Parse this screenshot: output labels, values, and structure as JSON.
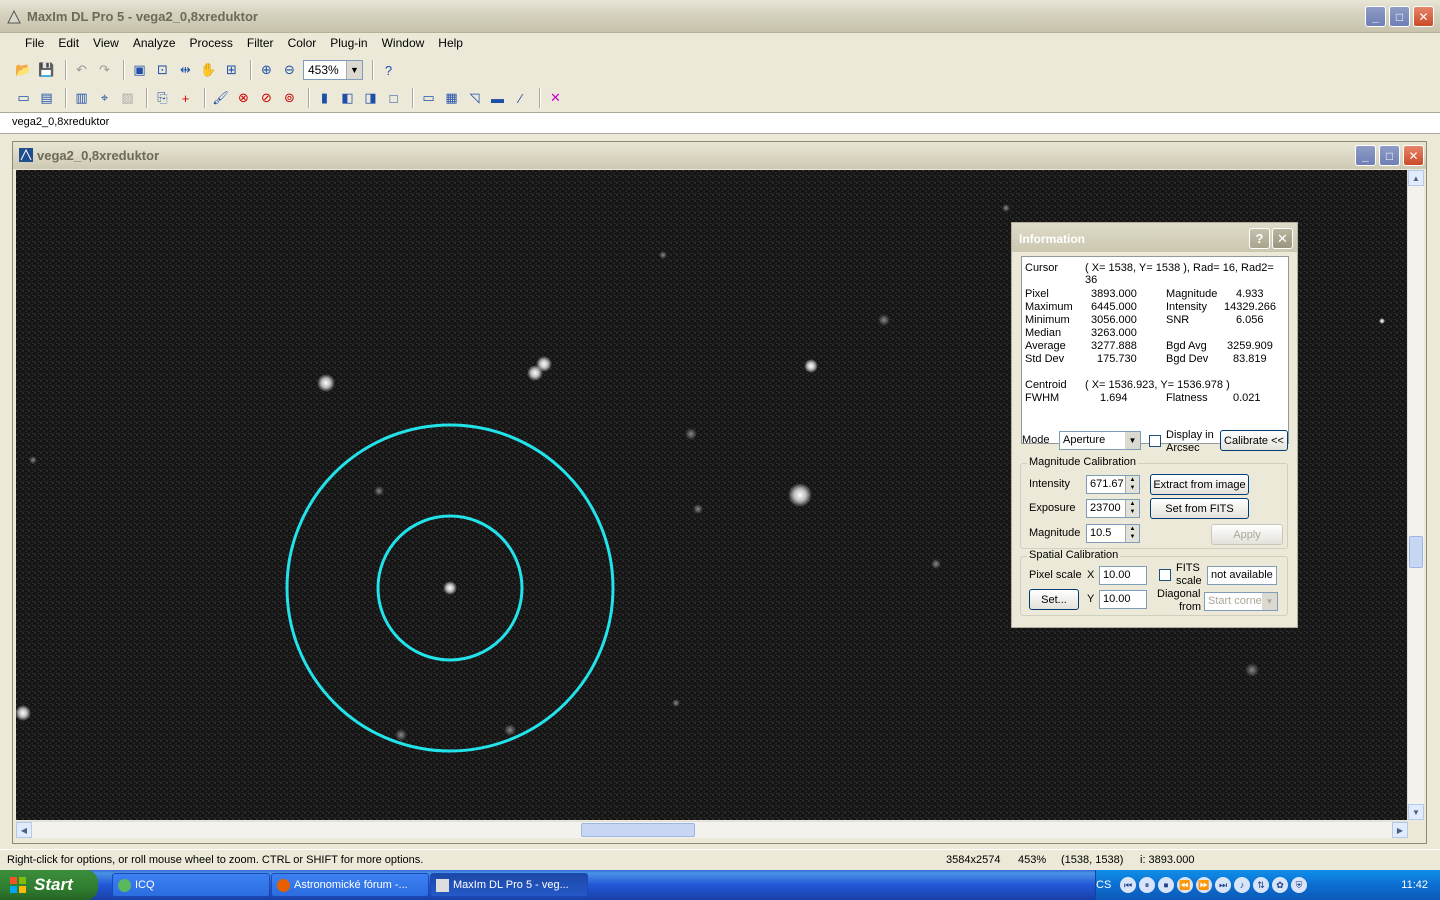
{
  "app": {
    "title": "MaxIm DL Pro 5 - vega2_0,8xreduktor",
    "menu": [
      "File",
      "Edit",
      "View",
      "Analyze",
      "Process",
      "Filter",
      "Color",
      "Plug-in",
      "Window",
      "Help"
    ],
    "zoom": "453%",
    "tab": "vega2_0,8xreduktor"
  },
  "image_window": {
    "title": "vega2_0,8xreduktor"
  },
  "info": {
    "title": "Information",
    "cursor_label": "Cursor",
    "cursor_value": "( X= 1538, Y= 1538 ), Rad= 16, Rad2= 36",
    "left_labels": [
      "Pixel",
      "Maximum",
      "Minimum",
      "Median",
      "Average",
      "Std Dev"
    ],
    "left_values": [
      "3893.000",
      "6445.000",
      "3056.000",
      "3263.000",
      "3277.888",
      "175.730"
    ],
    "right_labels": [
      "Magnitude",
      "Intensity",
      "SNR",
      "",
      "Bgd Avg",
      "Bgd Dev"
    ],
    "right_values": [
      "4.933",
      "14329.266",
      "6.056",
      "",
      "3259.909",
      "83.819"
    ],
    "centroid_label": "Centroid",
    "centroid_value": "( X= 1536.923, Y= 1536.978 )",
    "fwhm_label": "FWHM",
    "fwhm_value": "1.694",
    "flatness_label": "Flatness",
    "flatness_value": "0.021",
    "mode_label": "Mode",
    "mode_value": "Aperture",
    "display_arcsec_1": "Display in",
    "display_arcsec_2": "Arcsec",
    "calibrate_btn": "Calibrate <<",
    "mag_cal": {
      "legend": "Magnitude Calibration",
      "intensity_label": "Intensity",
      "intensity_value": "671.67",
      "exposure_label": "Exposure",
      "exposure_value": "23700",
      "magnitude_label": "Magnitude",
      "magnitude_value": "10.5",
      "extract_btn": "Extract from image",
      "fits_btn": "Set from FITS",
      "apply_btn": "Apply"
    },
    "spatial": {
      "legend": "Spatial Calibration",
      "pixel_scale_label": "Pixel scale",
      "x_label": "X",
      "x_value": "10.00",
      "y_label": "Y",
      "y_value": "10.00",
      "fits_scale_1": "FITS",
      "fits_scale_2": "scale",
      "not_available": "not available",
      "diagonal_1": "Diagonal",
      "diagonal_2": "from",
      "start_corner": "Start corner",
      "set_btn": "Set..."
    }
  },
  "status": {
    "hint": "Right-click for options, or roll mouse wheel to zoom. CTRL or SHIFT for more options.",
    "dims": "3584x2574",
    "zoom": "453%",
    "coords": "(1538, 1538)",
    "intensity": "i: 3893.000"
  },
  "taskbar": {
    "start": "Start",
    "tasks": [
      "ICQ",
      "Astronomické fórum -...",
      "MaxIm DL Pro 5 - veg..."
    ],
    "lang": "CS",
    "clock": "11:42"
  },
  "colors": {
    "aperture_ring": "#22e3ea"
  }
}
